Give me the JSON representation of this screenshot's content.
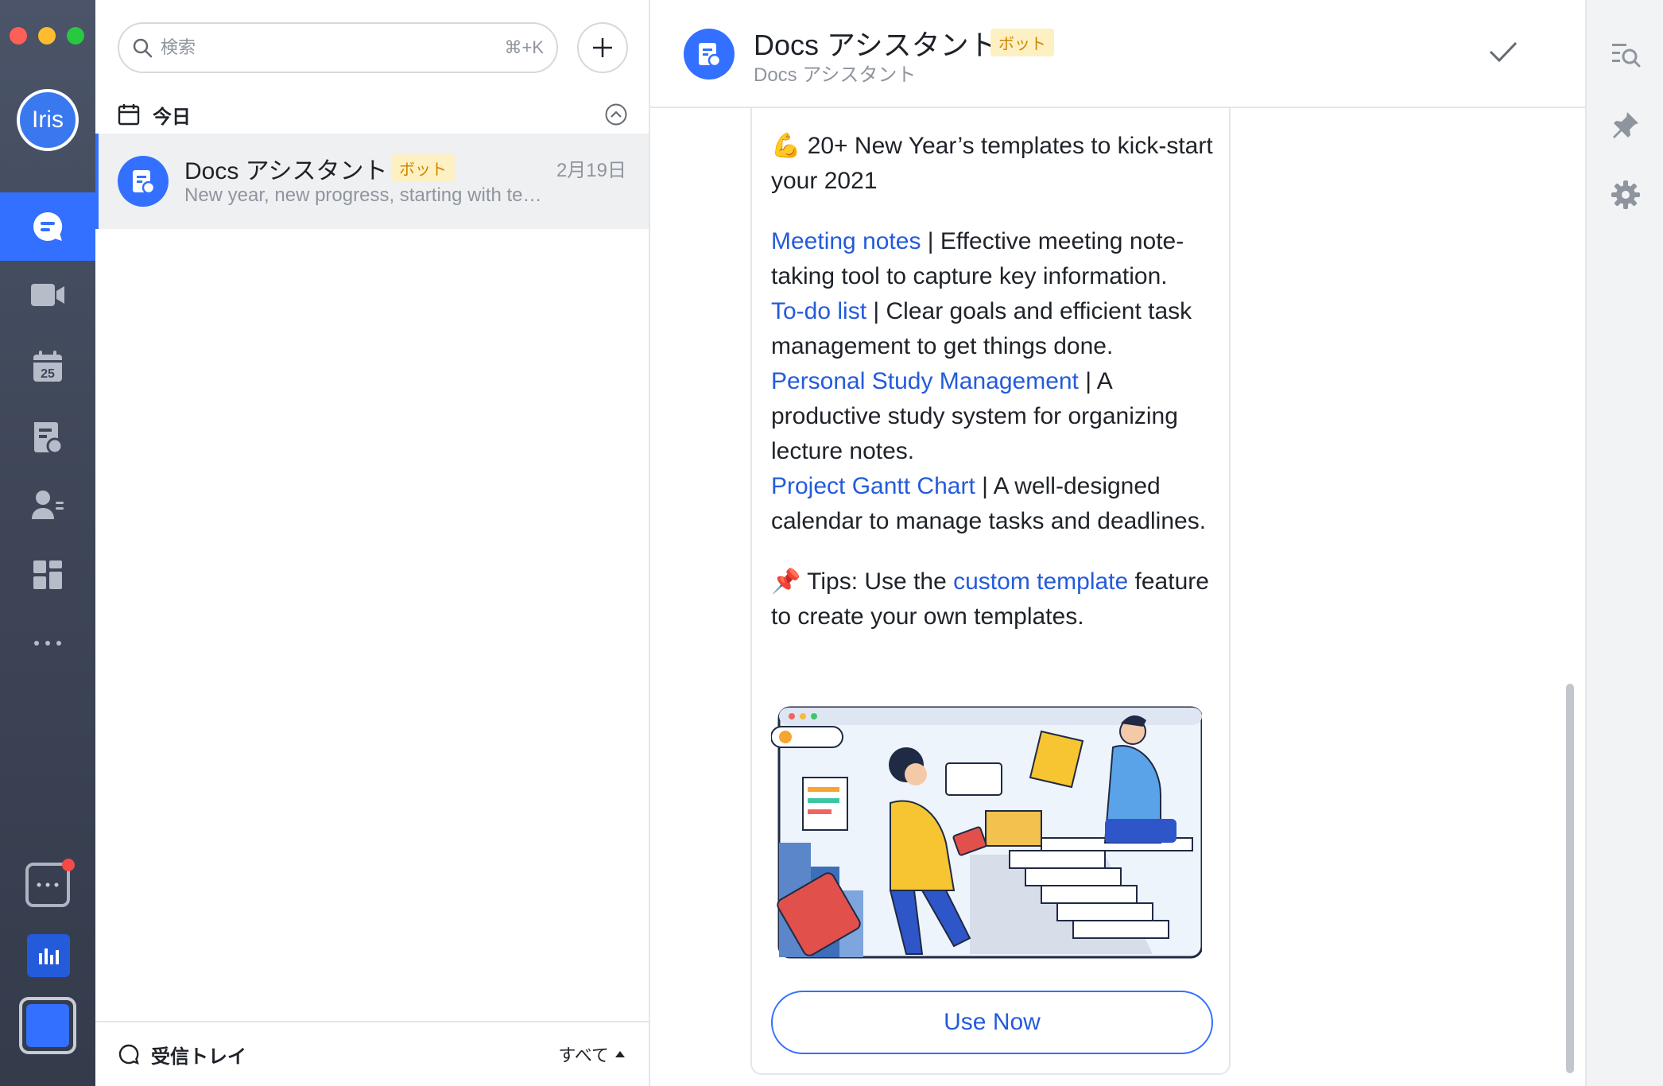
{
  "user": {
    "avatar_initials": "Iris"
  },
  "rail": {
    "items": [
      {
        "name": "messenger",
        "icon": "chat-bubble-icon",
        "active": true
      },
      {
        "name": "video",
        "icon": "video-camera-icon"
      },
      {
        "name": "calendar",
        "icon": "calendar-icon",
        "day": "25"
      },
      {
        "name": "docs",
        "icon": "document-cloud-icon"
      },
      {
        "name": "contacts",
        "icon": "contacts-icon"
      },
      {
        "name": "workplace",
        "icon": "app-grid-icon"
      },
      {
        "name": "more",
        "icon": "more-dots-icon"
      }
    ]
  },
  "search": {
    "placeholder": "検索",
    "shortcut": "⌘+K",
    "value": ""
  },
  "list": {
    "section_title": "今日",
    "items": [
      {
        "name": "Docs アシスタント",
        "badge": "ボット",
        "date": "2月19日",
        "preview": "New year, new progress, starting with te…"
      }
    ]
  },
  "inbox": {
    "label": "受信トレイ",
    "filter": "すべて"
  },
  "conversation": {
    "title": "Docs アシスタント",
    "badge": "ボット",
    "subtitle": "Docs アシスタント"
  },
  "card": {
    "intro": "💪 20+ New Year’s templates to kick-start your 2021",
    "templates": [
      {
        "link": "Meeting notes",
        "sep": " | ",
        "desc": "Effective meeting note-taking tool to capture key information."
      },
      {
        "link": "To-do list",
        "sep": " | ",
        "desc": "Clear goals and efficient task management to get things done."
      },
      {
        "link": "Personal Study Management",
        "sep": " | ",
        "desc": "A productive study system for organizing lecture notes."
      },
      {
        "link": "Project Gantt Chart",
        "sep": " | ",
        "desc": "A well-designed calendar to manage tasks and deadlines."
      }
    ],
    "tips": {
      "prefix": "📌 Tips: Use the ",
      "link": "custom template",
      "suffix": " feature to create your own templates."
    },
    "button": "Use Now"
  },
  "colors": {
    "accent": "#3370ff",
    "link": "#245bdb",
    "badge_bg": "#fdf0c2",
    "badge_text": "#d08600",
    "rail_bg": "#3e4658"
  }
}
